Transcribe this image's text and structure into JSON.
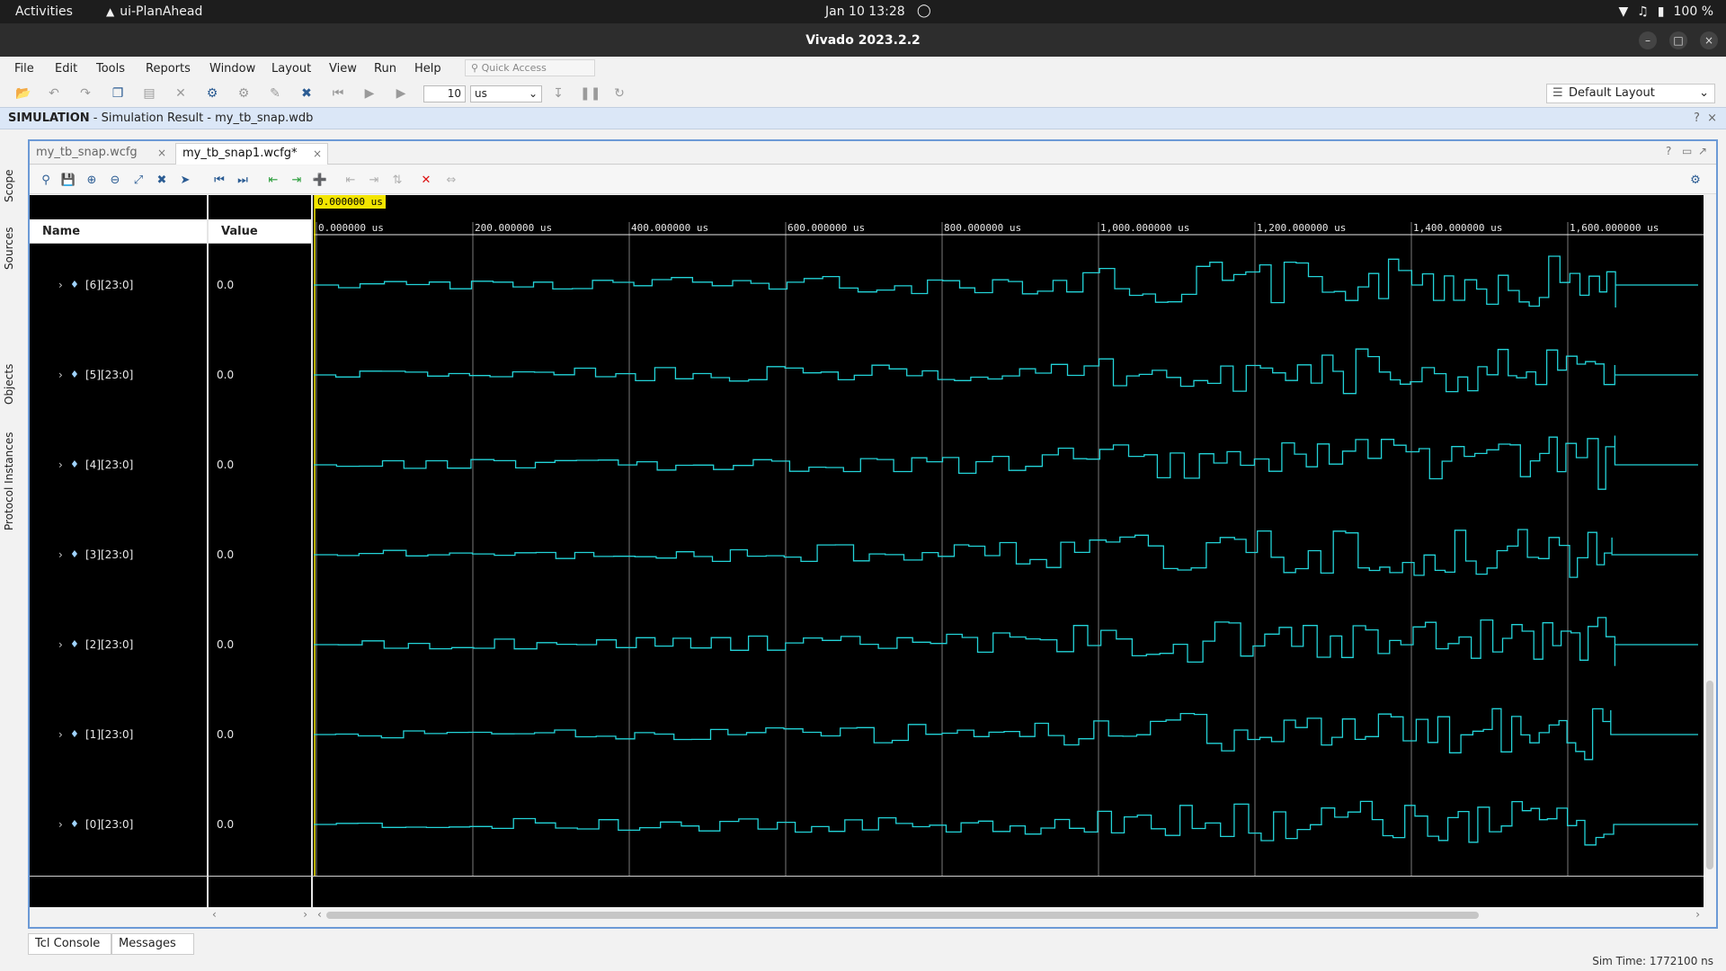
{
  "topbar": {
    "activities": "Activities",
    "app_name": "ui-PlanAhead",
    "clock": "Jan 10  13:28",
    "battery": "100 %"
  },
  "window": {
    "title": "Vivado 2023.2.2"
  },
  "menu": [
    "File",
    "Edit",
    "Tools",
    "Reports",
    "Window",
    "Layout",
    "View",
    "Run",
    "Help"
  ],
  "quick_access_placeholder": "Quick Access",
  "toolbar": {
    "time_value": "10",
    "time_unit": "us",
    "layout": "Default Layout"
  },
  "simbar": {
    "label": "SIMULATION",
    "text": " - Simulation Result - my_tb_snap.wdb"
  },
  "left_tabs": [
    "Scope",
    "Sources",
    "Objects",
    "Protocol Instances"
  ],
  "editor_tabs": [
    {
      "label": "my_tb_snap.wcfg",
      "active": false
    },
    {
      "label": "my_tb_snap1.wcfg*",
      "active": true
    }
  ],
  "columns": {
    "name": "Name",
    "value": "Value"
  },
  "cursor_time": "0.000000 us",
  "time_ticks": [
    "0.000000 us",
    "200.000000 us",
    "400.000000 us",
    "600.000000 us",
    "800.000000 us",
    "1,000.000000 us",
    "1,200.000000 us",
    "1,400.000000 us",
    "1,600.000000 us"
  ],
  "signals": [
    {
      "name": "[6][23:0]",
      "value": "0.0"
    },
    {
      "name": "[5][23:0]",
      "value": "0.0"
    },
    {
      "name": "[4][23:0]",
      "value": "0.0"
    },
    {
      "name": "[3][23:0]",
      "value": "0.0"
    },
    {
      "name": "[2][23:0]",
      "value": "0.0"
    },
    {
      "name": "[1][23:0]",
      "value": "0.0"
    },
    {
      "name": "[0][23:0]",
      "value": "0.0"
    }
  ],
  "bottom_tabs": [
    "Tcl Console",
    "Messages"
  ],
  "status": "Sim Time: 1772100 ns",
  "colors": {
    "wave": "#23d3d8",
    "accent": "#6c9ad6",
    "cursor": "#f3e500"
  }
}
